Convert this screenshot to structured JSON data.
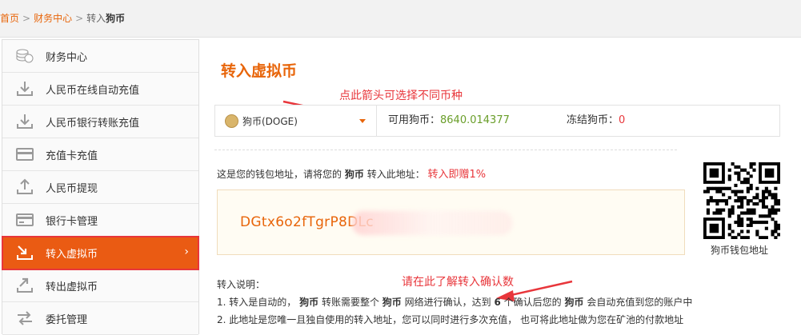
{
  "breadcrumb": {
    "home": "首页",
    "finance": "财务中心",
    "current_prefix": "转入",
    "current_coin": "狗币"
  },
  "sidebar": {
    "items": [
      {
        "label": "财务中心",
        "icon": "coin-stack-icon"
      },
      {
        "label": "人民币在线自动充值",
        "icon": "download-tray-icon"
      },
      {
        "label": "人民币银行转账充值",
        "icon": "download-tray-icon"
      },
      {
        "label": "充值卡充值",
        "icon": "card-icon"
      },
      {
        "label": "人民币提现",
        "icon": "upload-tray-icon"
      },
      {
        "label": "银行卡管理",
        "icon": "bank-card-icon"
      },
      {
        "label": "转入虚拟币",
        "icon": "transfer-in-icon",
        "active": true
      },
      {
        "label": "转出虚拟币",
        "icon": "transfer-out-icon"
      },
      {
        "label": "委托管理",
        "icon": "order-icon"
      }
    ]
  },
  "main": {
    "title": "转入虚拟币",
    "annotation_arrow": "点此箭头可选择不同币种",
    "coin_select": "狗币(DOGE)",
    "available_label": "可用狗币：",
    "available_value": "8640.014377",
    "frozen_label": "冻结狗币：",
    "frozen_value": "0",
    "address_intro_1": "这是您的钱包地址，请将您的",
    "address_intro_coin": "狗币",
    "address_intro_2": "转入此地址：",
    "bonus": "转入即赠1%",
    "address": "DGtx6o2fTgrP8DLc",
    "qr_label": "狗币钱包地址",
    "notes_title": "转入说明：",
    "annotation_confirm": "请在此了解转入确认数",
    "note1_a": "1. 转入是自动的，",
    "note1_coin1": "狗币",
    "note1_b": "转账需要整个",
    "note1_coin2": "狗币",
    "note1_c": "网络进行确认，达到",
    "note1_num": "6",
    "note1_d": "个确认后您的",
    "note1_coin3": "狗币",
    "note1_e": "会自动充值到您的账户中",
    "note2": "2. 此地址是您唯一且独自使用的转入地址，您可以同时进行多次充值， 也可将此地址做为您在矿池的付款地址"
  },
  "colors": {
    "accent": "#e8650a",
    "active_bg": "#ea5b13",
    "highlight_red": "#e8363b",
    "balance_green": "#6a9e2a"
  }
}
